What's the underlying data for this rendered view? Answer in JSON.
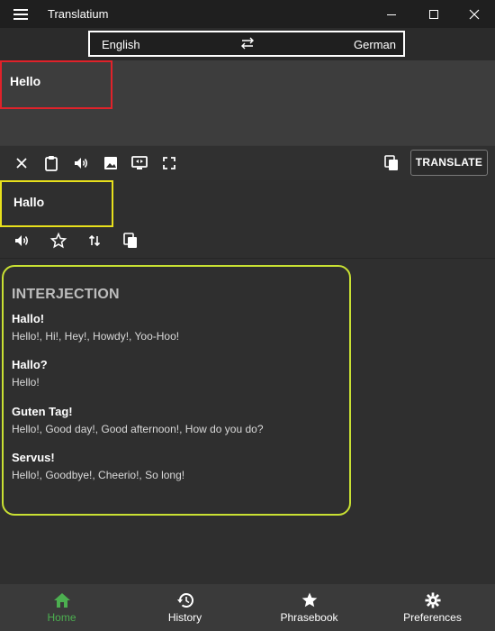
{
  "window": {
    "title": "Translatium"
  },
  "languages": {
    "source": "English",
    "target": "German"
  },
  "input": {
    "text": "Hello"
  },
  "toolbar": {
    "translate_label": "TRANSLATE"
  },
  "output": {
    "text": "Hallo"
  },
  "dictionary": {
    "part_of_speech": "INTERJECTION",
    "entries": [
      {
        "word": "Hallo!",
        "synonyms": "Hello!, Hi!, Hey!, Howdy!, Yoo-Hoo!"
      },
      {
        "word": "Hallo?",
        "synonyms": "Hello!"
      },
      {
        "word": "Guten Tag!",
        "synonyms": "Hello!, Good day!, Good afternoon!, How do you do?"
      },
      {
        "word": "Servus!",
        "synonyms": "Hello!, Goodbye!, Cheerio!, So long!"
      }
    ]
  },
  "nav": {
    "items": [
      {
        "label": "Home",
        "icon": "home-icon",
        "active": true
      },
      {
        "label": "History",
        "icon": "history-icon"
      },
      {
        "label": "Phrasebook",
        "icon": "star-icon"
      },
      {
        "label": "Preferences",
        "icon": "gear-icon"
      }
    ]
  },
  "colors": {
    "accent": "#4caf50",
    "highlight_red": "#e0222a",
    "highlight_yellow": "#e8e01c",
    "highlight_lime": "#c9e133"
  }
}
